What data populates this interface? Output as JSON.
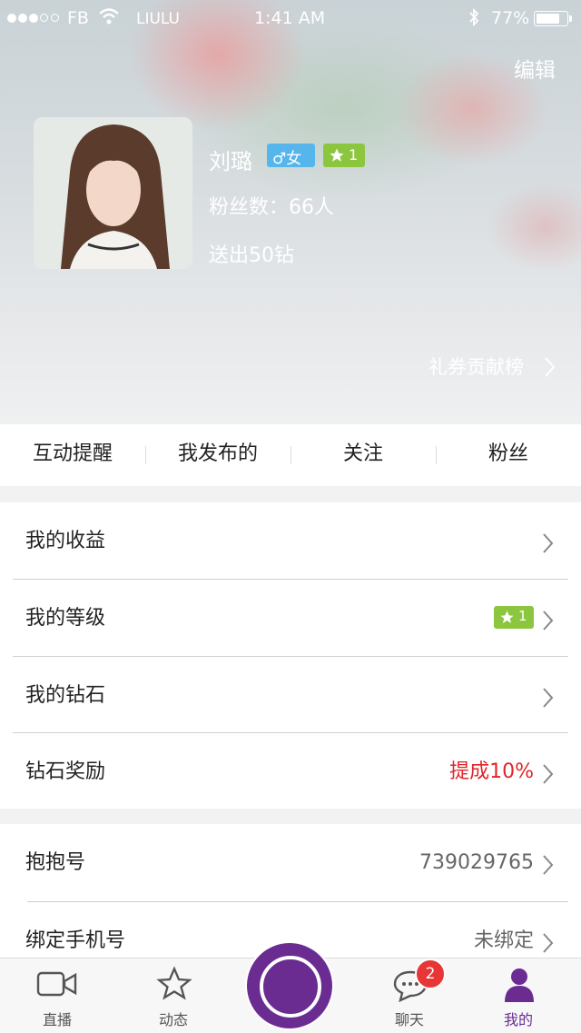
{
  "status_bar": {
    "carrier": "FB",
    "label": "LIULU",
    "time": "1:41 AM",
    "battery": "77%"
  },
  "header": {
    "edit_label": "编辑",
    "name": "刘璐",
    "gender": "♂女",
    "level": "1",
    "fans": "粉丝数：66人",
    "sent": "送出50钻",
    "contribution_link": "礼券贡献榜"
  },
  "tabs": [
    "互动提醒",
    "我发布的",
    "关注",
    "粉丝"
  ],
  "menu_group_1": [
    {
      "label": "我的收益",
      "value": ""
    },
    {
      "label": "我的等级",
      "value": "1"
    },
    {
      "label": "我的钻石",
      "value": ""
    },
    {
      "label": "钻石奖励",
      "value": "提成10%"
    }
  ],
  "menu_group_2": [
    {
      "label": "抱抱号",
      "value": "739029765"
    },
    {
      "label": "绑定手机号",
      "value": "未绑定"
    }
  ],
  "tabbar": {
    "items": [
      {
        "label": "直播",
        "icon": "video-camera-icon"
      },
      {
        "label": "动态",
        "icon": "star-icon"
      },
      {
        "label": "聊天",
        "icon": "chat-bubble-icon",
        "badge": "2"
      },
      {
        "label": "我的",
        "icon": "user-icon"
      }
    ]
  },
  "colors": {
    "accent": "#6a2c91",
    "gender_badge": "#56b6ec",
    "level_badge": "#8cc63f",
    "highlight_red": "#e0262a"
  }
}
